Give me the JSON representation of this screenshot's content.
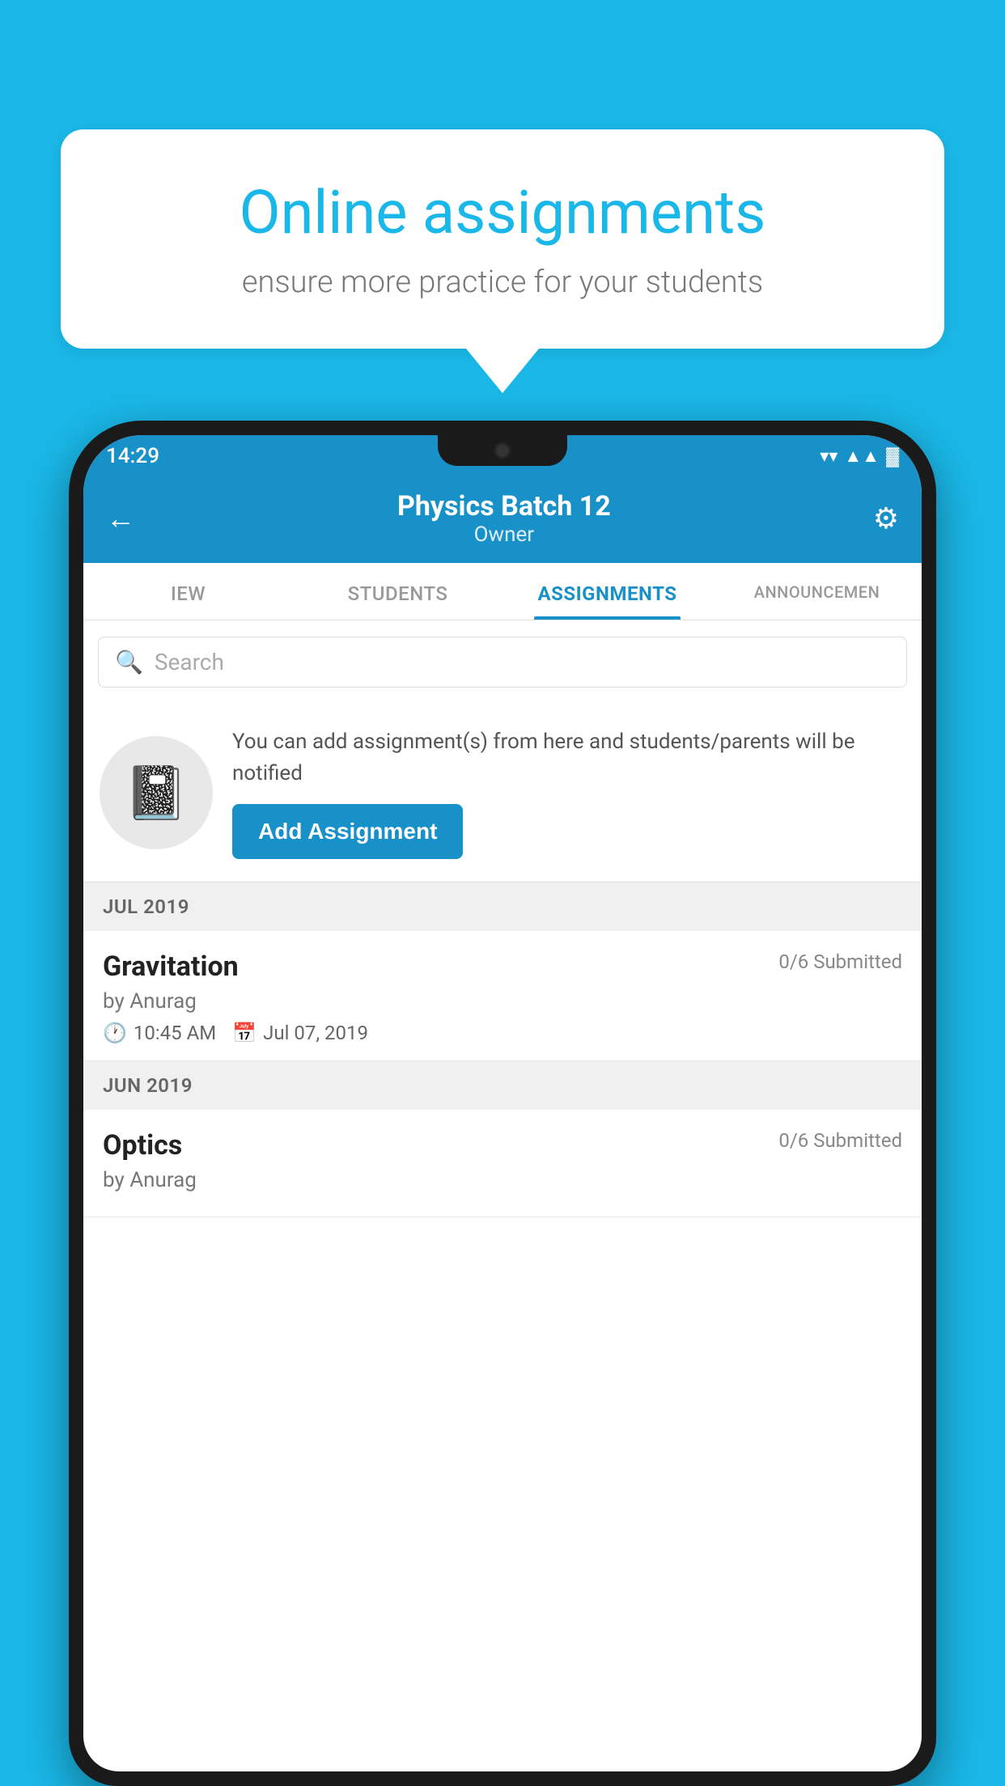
{
  "background_color": "#1AB8E8",
  "speech_bubble": {
    "title": "Online assignments",
    "subtitle": "ensure more practice for your students"
  },
  "status_bar": {
    "time": "14:29",
    "wifi": "▼",
    "signal": "▲",
    "battery": "▓"
  },
  "header": {
    "title": "Physics Batch 12",
    "subtitle": "Owner",
    "back_label": "←",
    "settings_label": "⚙"
  },
  "tabs": [
    {
      "id": "view",
      "label": "IEW",
      "active": false
    },
    {
      "id": "students",
      "label": "STUDENTS",
      "active": false
    },
    {
      "id": "assignments",
      "label": "ASSIGNMENTS",
      "active": true
    },
    {
      "id": "announcements",
      "label": "ANNOUNCEMENTS",
      "active": false
    }
  ],
  "search": {
    "placeholder": "Search"
  },
  "promo": {
    "text": "You can add assignment(s) from here and students/parents will be notified",
    "button_label": "Add Assignment"
  },
  "sections": [
    {
      "label": "JUL 2019",
      "items": [
        {
          "name": "Gravitation",
          "submitted": "0/6 Submitted",
          "author": "by Anurag",
          "time": "10:45 AM",
          "date": "Jul 07, 2019"
        }
      ]
    },
    {
      "label": "JUN 2019",
      "items": [
        {
          "name": "Optics",
          "submitted": "0/6 Submitted",
          "author": "by Anurag",
          "time": "",
          "date": ""
        }
      ]
    }
  ]
}
